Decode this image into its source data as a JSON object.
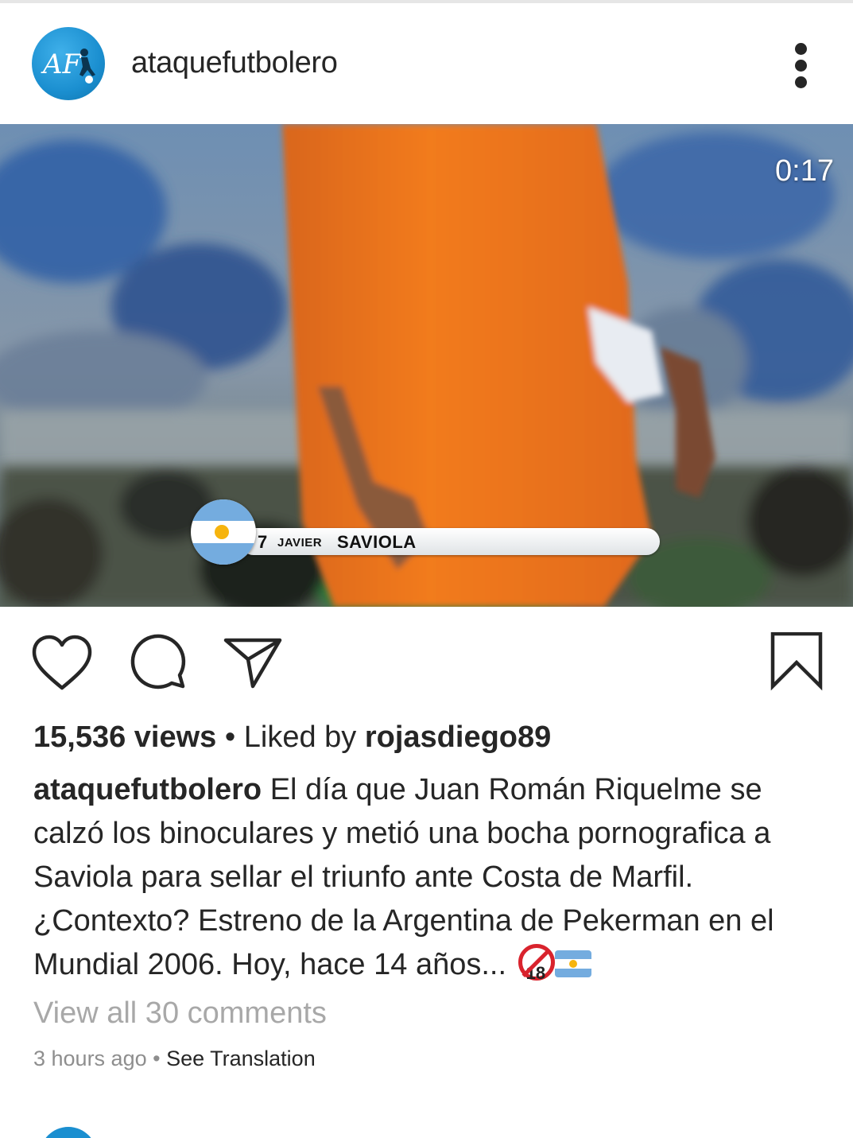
{
  "post": {
    "username": "ataquefutbolero",
    "avatar_text": "AF",
    "menu_icon": "more-vertical-icon",
    "video": {
      "duration": "0:17",
      "lower_third": {
        "number": "7",
        "first_name": "JAVIER",
        "last_name": "SAVIOLA"
      }
    },
    "actions": {
      "like_icon": "heart-icon",
      "comment_icon": "comment-icon",
      "share_icon": "send-icon",
      "save_icon": "bookmark-icon"
    },
    "views_count": "15,536 views",
    "separator": "•",
    "liked_by_prefix": "Liked by",
    "liked_by_user": "rojasdiego89",
    "caption_user": "ataquefutbolero",
    "caption_text": "El día que Juan Román Riquelme se calzó los binoculares y metió una bocha pornografica a Saviola para sellar el triunfo ante Costa de Marfil. ¿Contexto? Estreno de la Argentina de Pekerman en el Mundial 2006. Hoy, hace 14 años...",
    "caption_emojis": [
      "no-one-under-18-emoji",
      "argentina-flag-emoji"
    ],
    "view_comments": "View all 30 comments",
    "timestamp": "3 hours ago",
    "see_translation": "See Translation"
  },
  "colors": {
    "text": "#262626",
    "muted": "#a8a8a8",
    "avatar_blue": "#1b8fd0",
    "jersey_orange": "#f07a1c"
  }
}
